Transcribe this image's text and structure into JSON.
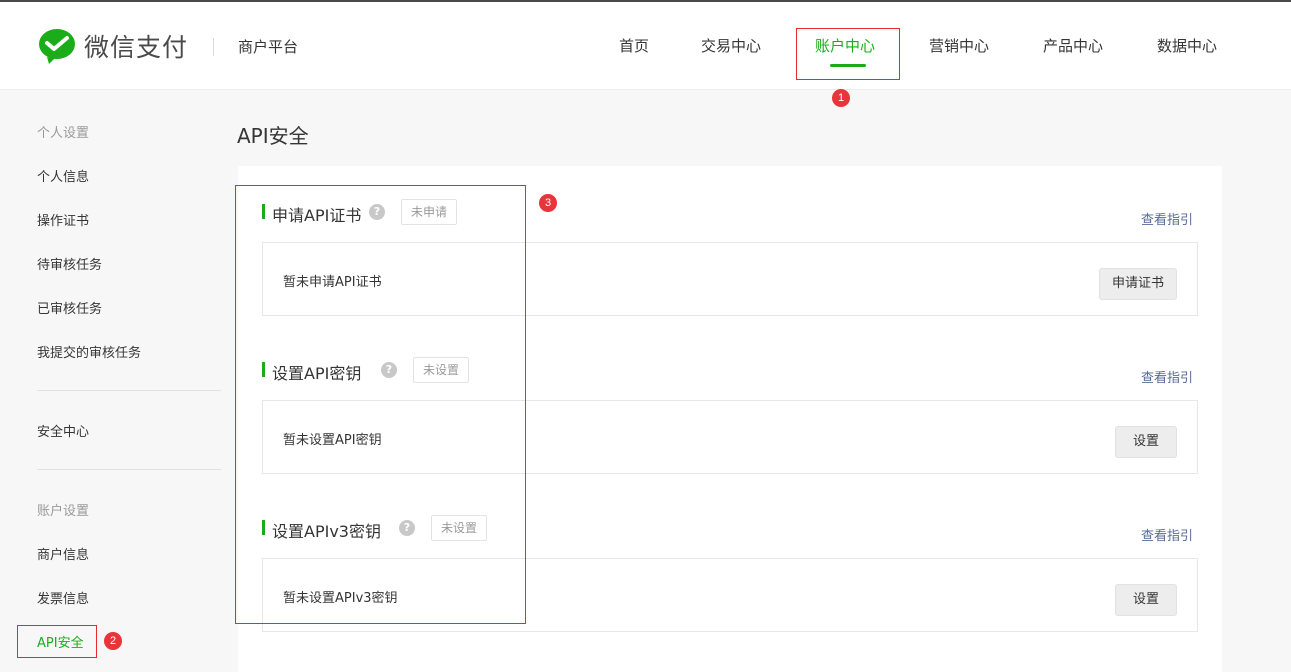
{
  "header": {
    "logo_text": "微信支付",
    "platform": "商户平台",
    "nav": [
      "首页",
      "交易中心",
      "账户中心",
      "营销中心",
      "产品中心",
      "数据中心"
    ],
    "active_nav_index": 2
  },
  "sidebar": {
    "group1_title": "个人设置",
    "group1_items": [
      "个人信息",
      "操作证书",
      "待审核任务",
      "已审核任务",
      "我提交的审核任务"
    ],
    "security_center": "安全中心",
    "group2_title": "账户设置",
    "group2_items": [
      "商户信息",
      "发票信息",
      "API安全"
    ],
    "active_item": "API安全"
  },
  "main": {
    "title": "API安全",
    "sections": [
      {
        "title": "申请API证书",
        "status": "未申请",
        "guide": "查看指引",
        "message": "暂未申请API证书",
        "button": "申请证书"
      },
      {
        "title": "设置API密钥",
        "status": "未设置",
        "guide": "查看指引",
        "message": "暂未设置API密钥",
        "button": "设置"
      },
      {
        "title": "设置APIv3密钥",
        "status": "未设置",
        "guide": "查看指引",
        "message": "暂未设置APIv3密钥",
        "button": "设置"
      }
    ]
  },
  "annotations": {
    "badge1": "1",
    "badge2": "2",
    "badge3": "3"
  },
  "colors": {
    "brand_green": "#1aad19",
    "link_blue": "#576b95",
    "annotation_red": "#e02d2d"
  },
  "icons": {
    "logo": "wechat-pay-logo-icon",
    "help": "question-circle-icon"
  }
}
